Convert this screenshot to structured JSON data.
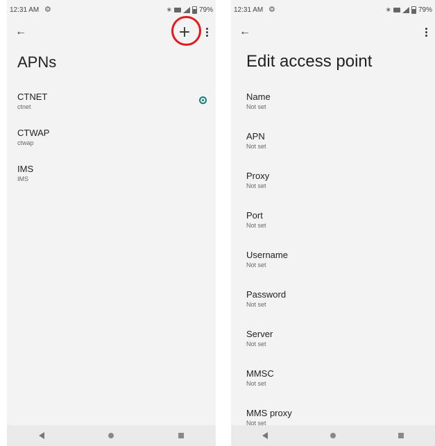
{
  "left_screen": {
    "status": {
      "time": "12:31 AM",
      "battery": "79%"
    },
    "title": "APNs",
    "apns": [
      {
        "name": "CTNET",
        "sub": "ctnet",
        "selected": true
      },
      {
        "name": "CTWAP",
        "sub": "ctwap",
        "selected": false
      },
      {
        "name": "IMS",
        "sub": "IMS",
        "selected": false
      }
    ],
    "highlight_color": "#e11b1b"
  },
  "right_screen": {
    "status": {
      "time": "12:31 AM",
      "battery": "79%"
    },
    "title": "Edit access point",
    "fields": [
      {
        "label": "Name",
        "value": "Not set"
      },
      {
        "label": "APN",
        "value": "Not set"
      },
      {
        "label": "Proxy",
        "value": "Not set"
      },
      {
        "label": "Port",
        "value": "Not set"
      },
      {
        "label": "Username",
        "value": "Not set"
      },
      {
        "label": "Password",
        "value": "Not set"
      },
      {
        "label": "Server",
        "value": "Not set"
      },
      {
        "label": "MMSC",
        "value": "Not set"
      },
      {
        "label": "MMS proxy",
        "value": "Not set"
      }
    ]
  },
  "icons": {
    "settings": "gear-icon",
    "bluetooth": "bluetooth-icon",
    "signal": "signal-icon",
    "battery": "battery-icon",
    "back": "back-arrow-icon",
    "add": "plus-icon",
    "more": "more-vert-icon",
    "radio": "radio-selected-icon",
    "nav_back": "nav-back-icon",
    "nav_home": "nav-home-icon",
    "nav_recents": "nav-recents-icon"
  },
  "colors": {
    "accent": "#167a7a",
    "background": "#f3f3f3"
  }
}
